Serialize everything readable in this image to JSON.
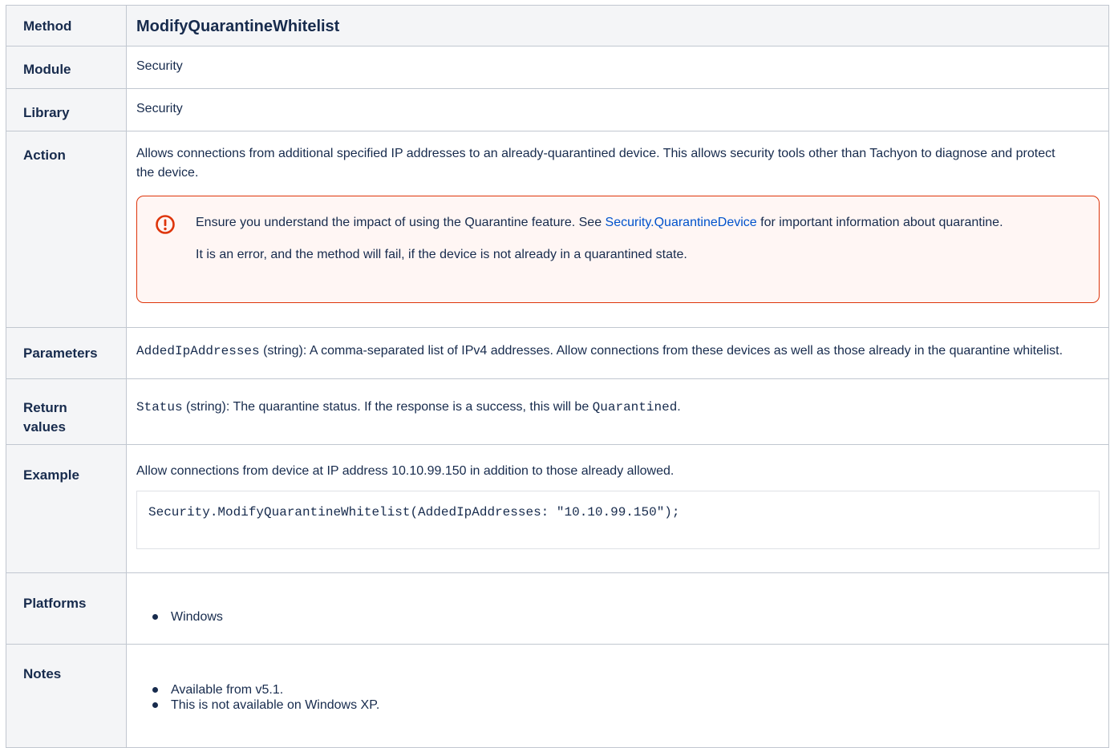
{
  "rows": {
    "method": {
      "label": "Method",
      "value": "ModifyQuarantineWhitelist"
    },
    "module": {
      "label": "Module",
      "value": "Security"
    },
    "library": {
      "label": "Library",
      "value": "Security"
    },
    "action": {
      "label": "Action",
      "text": "Allows connections from additional specified IP addresses to an already-quarantined device. This allows security tools other than Tachyon to diagnose and protect the device.",
      "warning": {
        "icon": "error-icon",
        "text_before": "Ensure you understand the impact of using the Quarantine feature. See ",
        "link": "Security.QuarantineDevice",
        "text_after": " for important information about quarantine.",
        "second": "It is an error, and the method will fail, if the device is not already in a quarantined state.",
        "border_color": "#de350b"
      }
    },
    "parameters": {
      "label": "Parameters",
      "param_name": "AddedIpAddresses",
      "param_desc": " (string): A comma-separated list of IPv4 addresses. Allow connections from these devices as well as those already in the quarantine whitelist."
    },
    "return_values": {
      "label": "Return values",
      "name": "Status",
      "desc": " (string): The quarantine status. If the response is a success, this will be ",
      "value": "Quarantined",
      "end": "."
    },
    "example": {
      "label": "Example",
      "text": "Allow connections from device at IP address 10.10.99.150 in addition to those already allowed.",
      "code": "Security.ModifyQuarantineWhitelist(AddedIpAddresses: \"10.10.99.150\");"
    },
    "platforms": {
      "label": "Platforms",
      "items": [
        "Windows"
      ]
    },
    "notes": {
      "label": "Notes",
      "items": [
        "Available from v5.1.",
        "This is not available on Windows XP."
      ]
    }
  },
  "colors": {
    "header_bg": "#f4f5f7",
    "border": "#c1c7d0",
    "link": "#0052cc",
    "warning_border": "#de350b"
  }
}
